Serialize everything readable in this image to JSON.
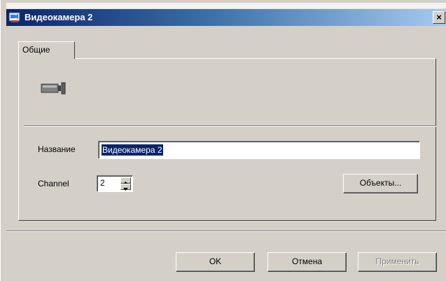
{
  "window": {
    "title": "Видеокамера 2",
    "close_glyph": "×",
    "icon": "camera-app-icon"
  },
  "tabs": [
    {
      "label": "Общие",
      "selected": true
    }
  ],
  "general": {
    "camera_icon": "video-camera-icon",
    "name_label": "Название",
    "name_value": "Видеокамера 2",
    "channel_label": "Channel",
    "channel_value": "2",
    "objects_button": "Объекты..."
  },
  "buttons": {
    "ok": "OK",
    "cancel": "Отмена",
    "apply": "Применить",
    "apply_disabled": true
  },
  "colors": {
    "title_gradient_start": "#0a246a",
    "title_gradient_end": "#a6caf0",
    "face": "#d4d0c8",
    "selection": "#0a246a"
  }
}
